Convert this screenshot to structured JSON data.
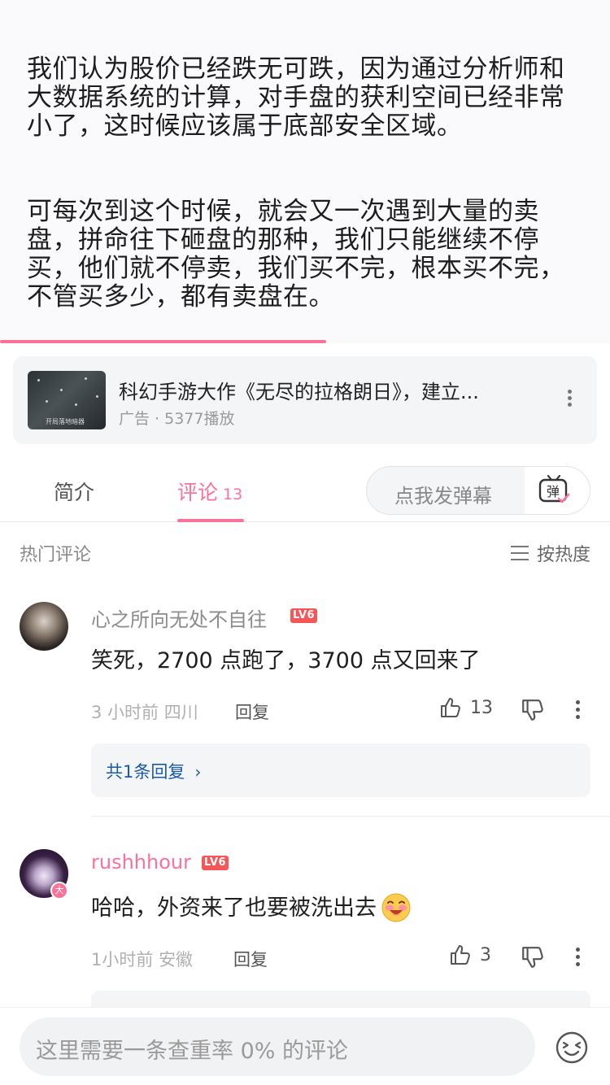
{
  "video": {
    "paragraphs": [
      "我们认为股价已经跌无可跌，因为通过分析师和大数据系统的计算，对手盘的获利空间已经非常小了，这时候应该属于底部安全区域。",
      "可每次到这个时候，就会又一次遇到大量的卖盘，拼命往下砸盘的那种，我们只能继续不停买，他们就不停卖，我们买不完，根本买不完，不管买多少，都有卖盘在。"
    ],
    "progress_percent": 53.5
  },
  "ad": {
    "thumb_caption": "开局落地暗器",
    "title": "科幻手游大作《无尽的拉格朗日》，建立...",
    "meta": "广告 · 5377播放",
    "more_icon": "more-vertical-icon"
  },
  "tabs": {
    "intro": "简介",
    "comments": "评论",
    "comments_count": "13"
  },
  "danmaku": {
    "placeholder": "点我发弹幕",
    "icon_label": "弹"
  },
  "comments_section": {
    "title": "热门评论",
    "sort_label": "按热度"
  },
  "comments": [
    {
      "username": "心之所向无处不自往",
      "level": "LV6",
      "text": "笑死，2700 点跑了，3700 点又回来了",
      "time": "3 小时前",
      "location": "四川",
      "reply_label": "回复",
      "likes": "13",
      "replies_link": "共1条回复",
      "replies_arrow": "›"
    },
    {
      "username": "rushhhour",
      "level": "LV6",
      "vip_badge": "大",
      "text": "哈哈，外资来了也要被洗出去",
      "time": "1小时前",
      "location": "安徽",
      "reply_label": "回复",
      "likes": "3"
    }
  ],
  "bottom_bar": {
    "placeholder": "这里需要一条查重率 0% 的评论",
    "emoji_icon": "emoji-face-icon"
  },
  "colors": {
    "accent": "#fb7299",
    "level_badge": "#f35757",
    "link_blue": "#1a5aa8"
  }
}
